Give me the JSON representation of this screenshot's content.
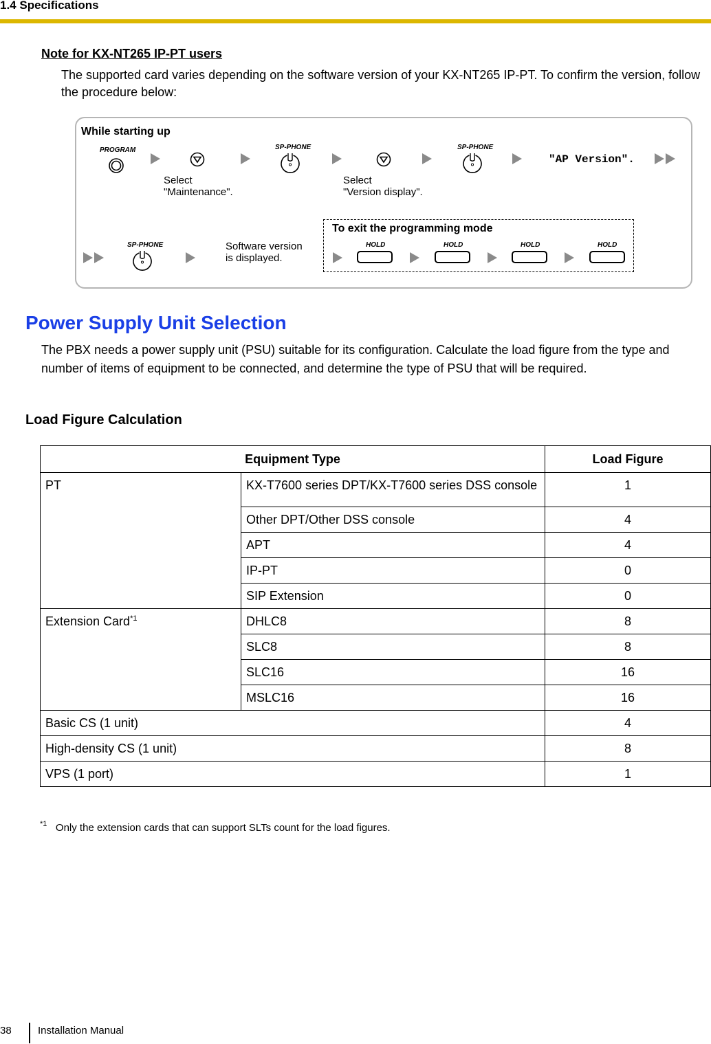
{
  "header": {
    "section": "1.4 Specifications"
  },
  "note": {
    "title": "Note for KX-NT265 IP-PT users",
    "body": "The supported card varies depending on the software version of your KX-NT265 IP-PT. To confirm the version, follow the procedure below:"
  },
  "procedure": {
    "start_label": "While starting up",
    "keys": {
      "program": "PROGRAM",
      "sp_phone": "SP-PHONE",
      "hold": "HOLD"
    },
    "step_maintenance": [
      "Select",
      "\"Maintenance\"."
    ],
    "step_version_display": [
      "Select",
      "\"Version display\"."
    ],
    "display_text": "\"AP Version\".",
    "result_text": [
      "Software version",
      "is displayed."
    ],
    "exit_label": "To exit the programming mode"
  },
  "psu": {
    "title": "Power Supply Unit Selection",
    "body": "The PBX needs a power supply unit (PSU) suitable for its configuration. Calculate the load figure from the type and number of items of equipment to be connected, and determine the type of PSU that will be required."
  },
  "load_figure": {
    "title": "Load Figure Calculation",
    "headers": {
      "equipment_type": "Equipment Type",
      "load_figure": "Load Figure"
    },
    "groups": [
      {
        "category": "PT",
        "footnote_ref": "",
        "items": [
          {
            "name": "KX-T7600 series DPT/KX-T7600 series DSS console",
            "value": "1"
          },
          {
            "name": "Other DPT/Other DSS console",
            "value": "4"
          },
          {
            "name": "APT",
            "value": "4"
          },
          {
            "name": "IP-PT",
            "value": "0"
          },
          {
            "name": "SIP Extension",
            "value": "0"
          }
        ]
      },
      {
        "category": "Extension Card",
        "footnote_ref": "*1",
        "items": [
          {
            "name": "DHLC8",
            "value": "8"
          },
          {
            "name": "SLC8",
            "value": "8"
          },
          {
            "name": "SLC16",
            "value": "16"
          },
          {
            "name": "MSLC16",
            "value": "16"
          }
        ]
      }
    ],
    "single_rows": [
      {
        "name": "Basic CS (1 unit)",
        "value": "4"
      },
      {
        "name": "High-density CS (1 unit)",
        "value": "8"
      },
      {
        "name": "VPS (1 port)",
        "value": "1"
      }
    ],
    "footnote": {
      "ref": "*1",
      "text": "Only the extension cards that can support SLTs count for the load figures."
    }
  },
  "footer": {
    "page_number": "38",
    "manual_title": "Installation Manual"
  },
  "colors": {
    "accent_rule": "#dcb700",
    "heading_blue": "#1a3fe6",
    "arrow_gray": "#8a8a8a"
  }
}
